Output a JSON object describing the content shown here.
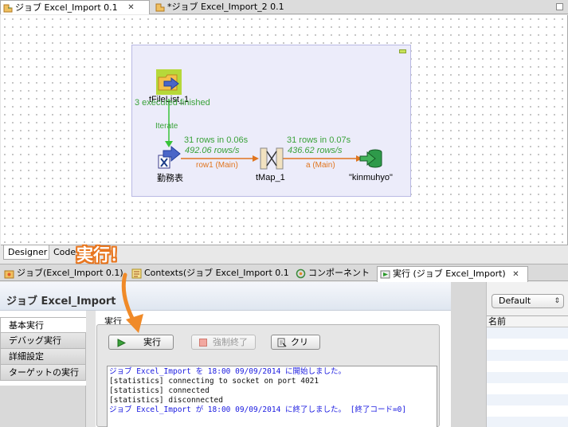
{
  "editor_tabs": [
    {
      "label": "ジョブ Excel_Import 0.1",
      "close": "✕"
    },
    {
      "label": "*ジョブ Excel_Import_2 0.1"
    }
  ],
  "canvas": {
    "nodes": {
      "filelist": {
        "label": "tFileList_1"
      },
      "excel": {
        "label": "勤務表"
      },
      "tmap": {
        "label": "tMap_1"
      },
      "output": {
        "label": "\"kinmuhyo\""
      }
    },
    "status_label": "3 executed finished",
    "iterate_label": "Iterate",
    "link1": {
      "rows": "31 rows in 0.06s",
      "rate": "492.06 rows/s",
      "name": "row1 (Main)"
    },
    "link2": {
      "rows": "31 rows in 0.07s",
      "rate": "436.62 rows/s",
      "name": "a (Main)"
    }
  },
  "canvas_tabs": [
    "Designer",
    "Code"
  ],
  "view_tabs": [
    {
      "label": "ジョブ(Excel_Import 0.1)"
    },
    {
      "label": "Contexts(ジョブ Excel_Import 0.1"
    },
    {
      "label": "コンポーネント"
    },
    {
      "label": "実行 (ジョブ Excel_Import)",
      "close": "✕"
    }
  ],
  "run_panel": {
    "title": "ジョブ Excel_Import",
    "side_nav": [
      "基本実行",
      "デバッグ実行",
      "詳細設定",
      "ターゲットの実行"
    ],
    "section_label": "実行",
    "buttons": {
      "run": "実行",
      "kill": "強制終了",
      "clear": "クリ"
    },
    "console": [
      {
        "text": "ジョブ Excel_Import を 18:00 09/09/2014 に開始しました。",
        "color": "blue"
      },
      {
        "text": "[statistics] connecting to socket on port 4021",
        "color": "black"
      },
      {
        "text": "[statistics] connected",
        "color": "black"
      },
      {
        "text": "[statistics] disconnected",
        "color": "black"
      },
      {
        "text": "ジョブ Excel_Import が 18:00 09/09/2014 に終了しました。 [終了コード=0]",
        "color": "blue"
      }
    ]
  },
  "context_panel": {
    "select_value": "Default",
    "column_header": "名前"
  },
  "annotation": "実行！",
  "colors": {
    "accent": "#e8761f",
    "link_main": "#e0751f",
    "stats": "#3aa23a"
  }
}
